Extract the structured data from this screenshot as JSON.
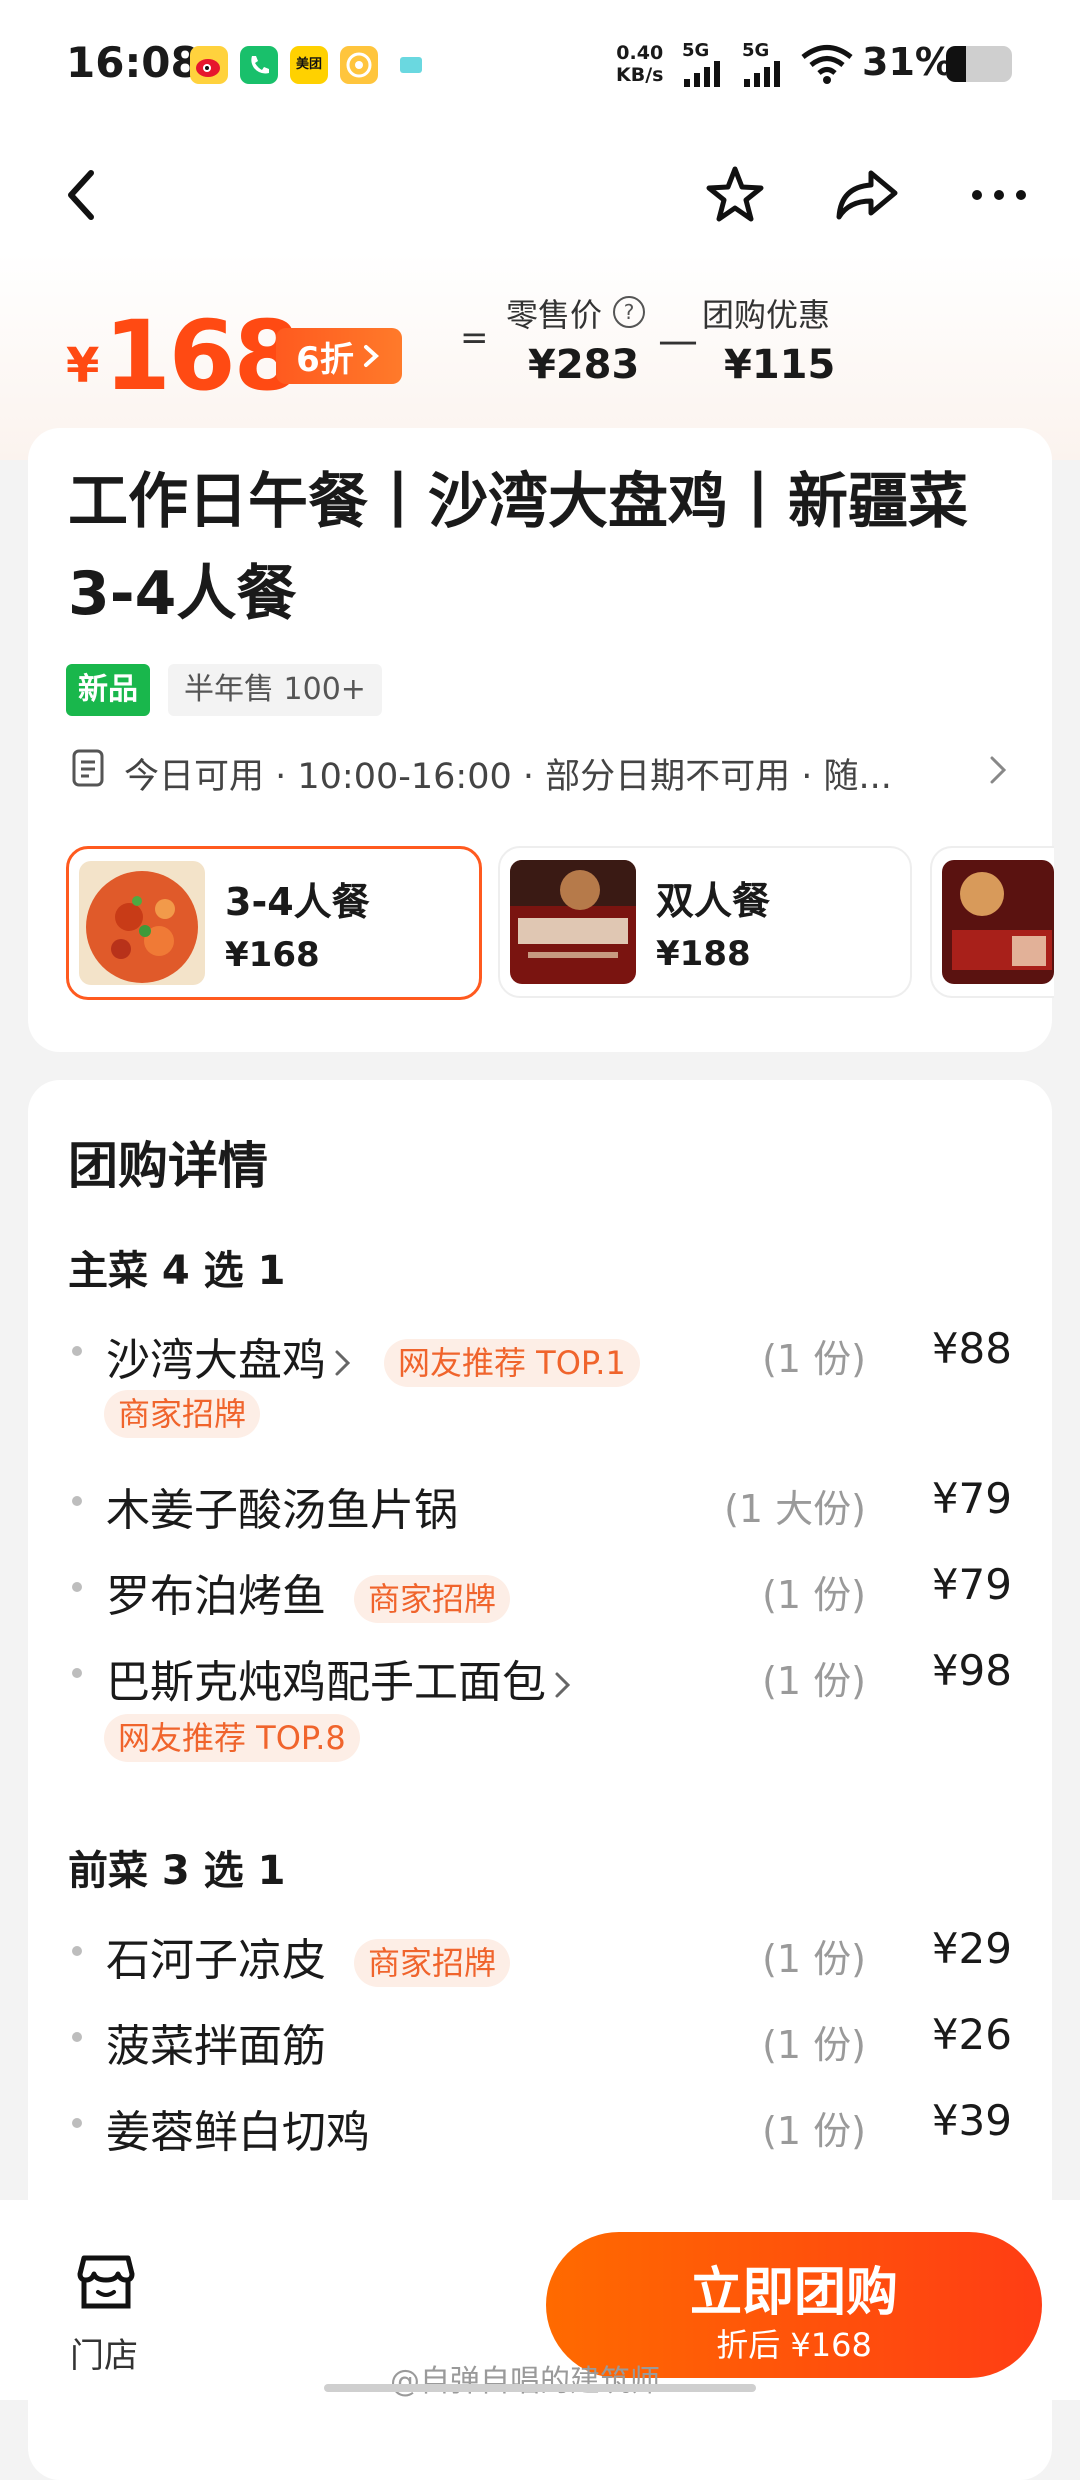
{
  "status_bar": {
    "time": "16:08",
    "net_speed_value": "0.40",
    "net_speed_unit": "KB/s",
    "signal_1": "5G",
    "signal_2": "5G",
    "battery_percent": "31%",
    "battery_level": 0.31,
    "app_icons": [
      "weibo-icon",
      "phone-app-icon",
      "meituan-icon",
      "coin-app-icon",
      "message-app-icon"
    ],
    "meituan_label": "美团"
  },
  "nav": {
    "icons": [
      "back-icon",
      "favorite-star-icon",
      "share-icon",
      "more-icon"
    ]
  },
  "price": {
    "currency": "¥",
    "current": "168",
    "discount": "6折",
    "equals": "=",
    "retail_label": "零售价",
    "retail_value": "¥283",
    "minus": "—",
    "group_label": "团购优惠",
    "group_value": "¥115"
  },
  "deal": {
    "title": "工作日午餐丨沙湾大盘鸡丨新疆菜3-4人餐",
    "badge_new": "新品",
    "sales": "半年售 100+",
    "availability": "今日可用 · 10:00-16:00 · 部分日期不可用 · 随..."
  },
  "options": [
    {
      "name": "3-4人餐",
      "price": "¥168",
      "selected": true
    },
    {
      "name": "双人餐",
      "price": "¥188",
      "selected": false
    },
    {
      "name": "",
      "price": "",
      "selected": false
    }
  ],
  "details": {
    "title": "团购详情",
    "groups": [
      {
        "title": "主菜 4 选 1",
        "items": [
          {
            "name": "沙湾大盘鸡",
            "tag": "网友推荐 TOP.1",
            "tag2": "商家招牌",
            "qty": "(1 份)",
            "price": "¥88"
          },
          {
            "name": "木姜子酸汤鱼片锅",
            "qty": "(1 大份)",
            "price": "¥79"
          },
          {
            "name": "罗布泊烤鱼",
            "tag": "商家招牌",
            "qty": "(1 份)",
            "price": "¥79"
          },
          {
            "name": "巴斯克炖鸡配手工面包",
            "tag2": "网友推荐 TOP.8",
            "qty": "(1 份)",
            "price": "¥98"
          }
        ]
      },
      {
        "title": "前菜 3 选 1",
        "items": [
          {
            "name": "石河子凉皮",
            "tag": "商家招牌",
            "qty": "(1 份)",
            "price": "¥29"
          },
          {
            "name": "菠菜拌面筋",
            "qty": "(1 份)",
            "price": "¥26"
          },
          {
            "name": "姜蓉鲜白切鸡",
            "qty": "(1 份)",
            "price": "¥39"
          }
        ]
      }
    ]
  },
  "bottom": {
    "store_label": "门店",
    "buy_label": "立即团购",
    "buy_sub": "折后 ¥168"
  },
  "watermark": "@自弹自唱的建筑师",
  "colors": {
    "accent": "#ff4a13",
    "tag_bg": "#fdeee6",
    "tag_text": "#f0642c",
    "new_badge": "#19b74c"
  }
}
